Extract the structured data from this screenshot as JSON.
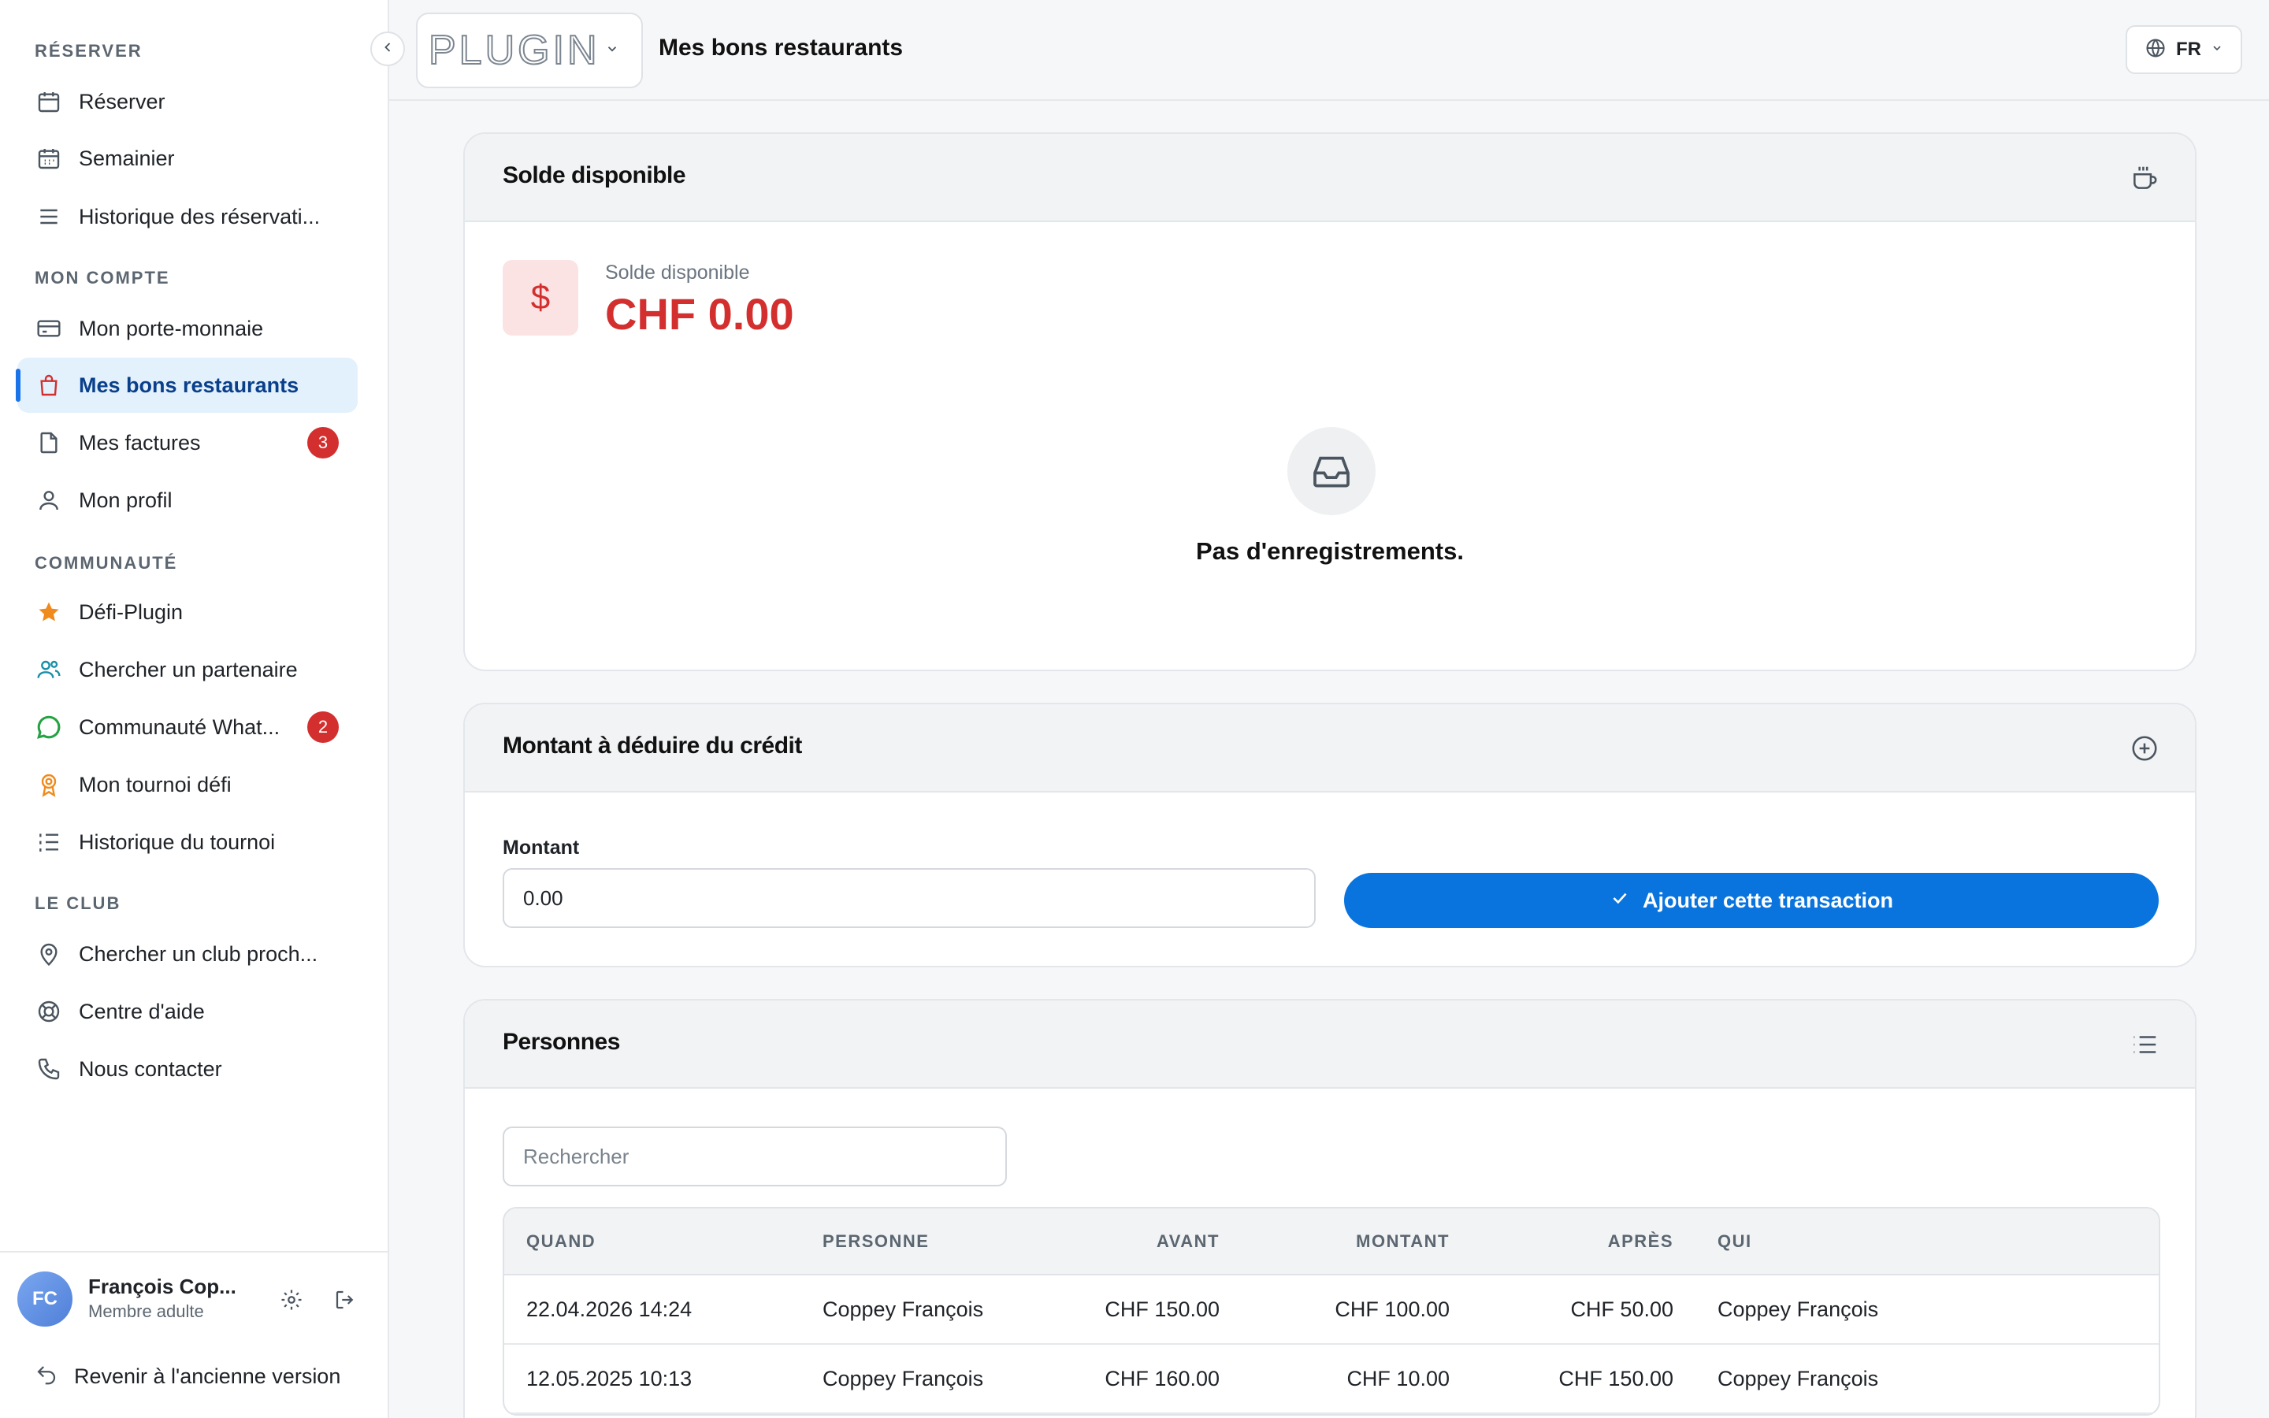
{
  "sidebar": {
    "sections": [
      {
        "title": "RÉSERVER"
      },
      {
        "title": "MON COMPTE"
      },
      {
        "title": "COMMUNAUTÉ"
      },
      {
        "title": "LE CLUB"
      }
    ],
    "items": [
      {
        "label": "Réserver",
        "icon": "calendar-icon"
      },
      {
        "label": "Semainier",
        "icon": "calendar-grid-icon"
      },
      {
        "label": "Historique des réservati...",
        "icon": "list-icon"
      },
      {
        "label": "Mon porte-monnaie",
        "icon": "credit-card-icon"
      },
      {
        "label": "Mes bons restaurants",
        "icon": "shopping-bag-icon",
        "active": true
      },
      {
        "label": "Mes factures",
        "icon": "file-icon",
        "badge": "3"
      },
      {
        "label": "Mon profil",
        "icon": "user-icon"
      },
      {
        "label": "Défi-Plugin",
        "icon": "star-icon"
      },
      {
        "label": "Chercher un partenaire",
        "icon": "users-icon"
      },
      {
        "label": "Communauté What...",
        "icon": "whatsapp-icon",
        "badge": "2"
      },
      {
        "label": "Mon tournoi défi",
        "icon": "award-icon"
      },
      {
        "label": "Historique du tournoi",
        "icon": "list-ordered-icon"
      },
      {
        "label": "Chercher un club proch...",
        "icon": "map-pin-icon"
      },
      {
        "label": "Centre d'aide",
        "icon": "lifebuoy-icon"
      },
      {
        "label": "Nous contacter",
        "icon": "phone-icon"
      }
    ],
    "user": {
      "initials": "FC",
      "name": "François Cop...",
      "role": "Membre adulte"
    },
    "back_label": "Revenir à l'ancienne version"
  },
  "header": {
    "logo": "PLUGIN",
    "title": "Mes bons restaurants",
    "lang": "FR"
  },
  "balance_card": {
    "title": "Solde disponible",
    "label": "Solde disponible",
    "amount": "CHF 0.00",
    "currency_symbol": "$",
    "empty_text": "Pas d'enregistrements."
  },
  "deduct_card": {
    "title": "Montant à déduire du crédit",
    "field_label": "Montant",
    "field_value": "0.00",
    "button_label": "Ajouter cette transaction"
  },
  "persons_card": {
    "title": "Personnes",
    "search_placeholder": "Rechercher",
    "columns": [
      "QUAND",
      "PERSONNE",
      "AVANT",
      "MONTANT",
      "APRÈS",
      "QUI"
    ],
    "rows": [
      [
        "22.04.2026 14:24",
        "Coppey François",
        "CHF 150.00",
        "CHF 100.00",
        "CHF 50.00",
        "Coppey François"
      ],
      [
        "12.05.2025 10:13",
        "Coppey François",
        "CHF 160.00",
        "CHF 10.00",
        "CHF 150.00",
        "Coppey François"
      ]
    ]
  },
  "colors": {
    "accent": "#0a74de",
    "danger": "#d32f2f",
    "active_bg": "#e3f1fd"
  }
}
